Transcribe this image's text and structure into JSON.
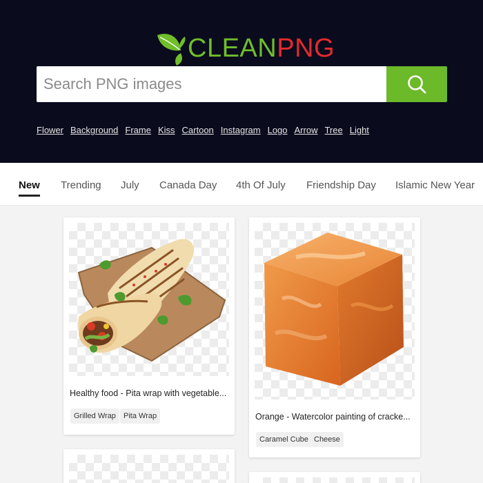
{
  "brand": {
    "clean": "CLEAN",
    "png": "PNG"
  },
  "search": {
    "placeholder": "Search PNG images",
    "icon": "search-icon"
  },
  "quick_links": [
    "Flower",
    "Background",
    "Frame",
    "Kiss",
    "Cartoon",
    "Instagram",
    "Logo",
    "Arrow",
    "Tree",
    "Light"
  ],
  "tabs": [
    "New",
    "Trending",
    "July",
    "Canada Day",
    "4th Of July",
    "Friendship Day",
    "Islamic New Year"
  ],
  "active_tab": "New",
  "cards": [
    {
      "title": "Healthy food - Pita wrap with vegetable...",
      "tags": [
        "Grilled Wrap",
        "Pita Wrap"
      ]
    },
    {
      "title": "Orange - Watercolor painting of cracke...",
      "tags": [
        "Caramel Cube",
        "Cheese"
      ]
    }
  ],
  "colors": {
    "header_bg": "#0b0b1e",
    "accent_green": "#6cb92a",
    "brand_red": "#e32b2b"
  }
}
